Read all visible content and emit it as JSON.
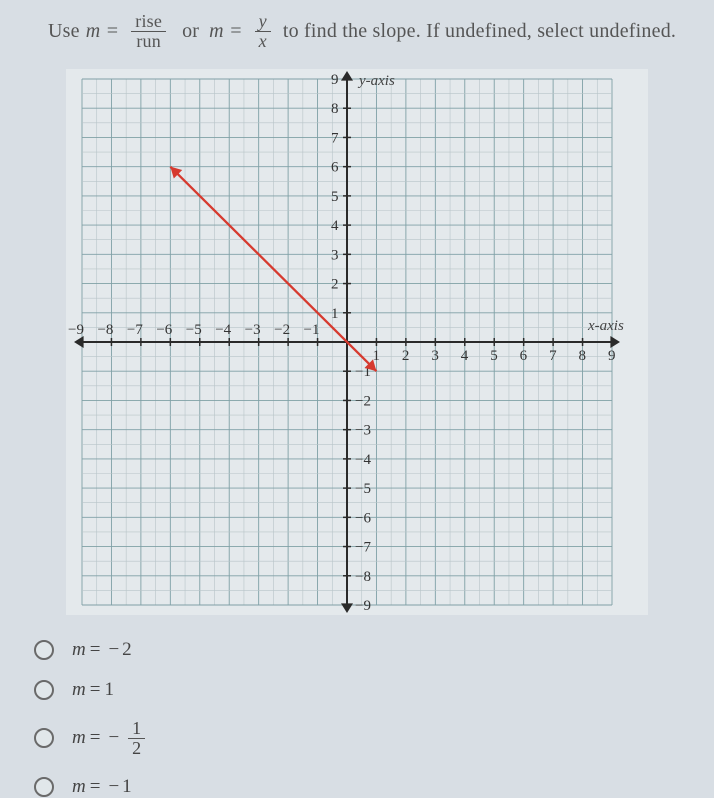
{
  "prompt": {
    "use": "Use",
    "m_eq": "m =",
    "frac1_num": "rise",
    "frac1_den": "run",
    "or": "or",
    "frac2_num": "y",
    "frac2_den": "x",
    "rest": "to find the slope. If undefined, select undefined."
  },
  "chart_data": {
    "type": "line",
    "x": [
      -6,
      1
    ],
    "y": [
      6,
      -1
    ],
    "xlabel": "x-axis",
    "ylabel": "y-axis",
    "xlim": [
      -9,
      9
    ],
    "ylim": [
      -9,
      9
    ],
    "xticks": [
      -9,
      -8,
      -7,
      -6,
      -5,
      -4,
      -3,
      -2,
      -1,
      1,
      2,
      3,
      4,
      5,
      6,
      7,
      8,
      9
    ],
    "yticks": [
      -9,
      -8,
      -7,
      -6,
      -5,
      -4,
      -3,
      -2,
      -1,
      1,
      2,
      3,
      4,
      5,
      6,
      7,
      8,
      9
    ]
  },
  "options": [
    {
      "var": "m",
      "eq": "=",
      "neg": "−",
      "val": "2"
    },
    {
      "var": "m",
      "eq": "=",
      "val": "1"
    },
    {
      "var": "m",
      "eq": "=",
      "neg": "−",
      "frac_num": "1",
      "frac_den": "2"
    },
    {
      "var": "m",
      "eq": "=",
      "neg": "−",
      "val": "1"
    }
  ]
}
